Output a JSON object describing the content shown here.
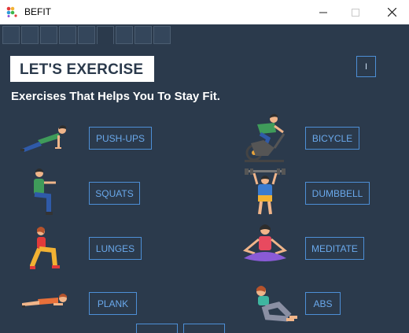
{
  "window": {
    "title": "BEFIT",
    "minimize_icon": "minimize-icon",
    "maximize_icon": "maximize-icon",
    "close_icon": "close-icon"
  },
  "header": {
    "title": "LET'S EXERCISE",
    "info_label": "I"
  },
  "subtitle": "Exercises That Helps You To Stay Fit.",
  "exercises": [
    {
      "label": "PUSH-UPS",
      "icon": "push-ups-icon"
    },
    {
      "label": "BICYCLE",
      "icon": "bicycle-icon"
    },
    {
      "label": "SQUATS",
      "icon": "squats-icon"
    },
    {
      "label": "DUMBBELL",
      "icon": "dumbbell-icon"
    },
    {
      "label": "LUNGES",
      "icon": "lunges-icon"
    },
    {
      "label": "MEDITATE",
      "icon": "meditate-icon"
    },
    {
      "label": "PLANK",
      "icon": "plank-icon"
    },
    {
      "label": "ABS",
      "icon": "abs-icon"
    }
  ],
  "colors": {
    "background": "#2b3a4c",
    "accent": "#4d8fd6",
    "button_text": "#6aa9ec"
  }
}
